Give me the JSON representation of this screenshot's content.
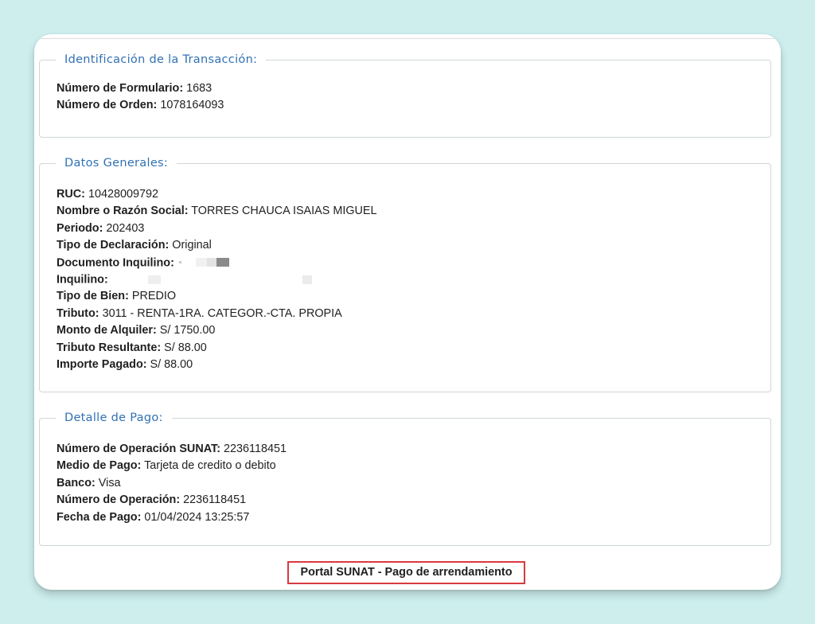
{
  "footer": {
    "caption": "Portal SUNAT - Pago de arrendamiento"
  },
  "identificacion": {
    "legend": "Identificación de la Transacción:",
    "numero_formulario": {
      "label": "Número de Formulario:",
      "value": "1683"
    },
    "numero_orden": {
      "label": "Número de Orden:",
      "value": "1078164093"
    }
  },
  "datos": {
    "legend": "Datos Generales:",
    "ruc": {
      "label": "RUC:",
      "value": "10428009792"
    },
    "razon_social": {
      "label": "Nombre o Razón Social:",
      "value": "TORRES CHAUCA ISAIAS MIGUEL"
    },
    "periodo": {
      "label": "Periodo:",
      "value": "202403"
    },
    "tipo_declaracion": {
      "label": "Tipo de Declaración:",
      "value": "Original"
    },
    "documento_inquilino": {
      "label": "Documento Inquilino:",
      "value": ""
    },
    "inquilino": {
      "label": "Inquilino:",
      "value": ""
    },
    "tipo_bien": {
      "label": "Tipo de Bien:",
      "value": "PREDIO"
    },
    "tributo": {
      "label": "Tributo:",
      "value": "3011 - RENTA-1RA. CATEGOR.-CTA. PROPIA"
    },
    "monto_alquiler": {
      "label": "Monto de Alquiler:",
      "value": "S/ 1750.00"
    },
    "tributo_resultante": {
      "label": "Tributo Resultante:",
      "value": "S/ 88.00"
    },
    "importe_pagado": {
      "label": "Importe Pagado:",
      "value": "S/ 88.00"
    }
  },
  "detalle": {
    "legend": "Detalle de Pago:",
    "operacion_sunat": {
      "label": "Número de Operación SUNAT:",
      "value": "2236118451"
    },
    "medio_pago": {
      "label": "Medio de Pago:",
      "value": "Tarjeta de credito o debito"
    },
    "banco": {
      "label": "Banco:",
      "value": "Visa"
    },
    "numero_operacion": {
      "label": "Número de Operación:",
      "value": "2236118451"
    },
    "fecha_pago": {
      "label": "Fecha de Pago:",
      "value": "01/04/2024 13:25:57"
    }
  }
}
